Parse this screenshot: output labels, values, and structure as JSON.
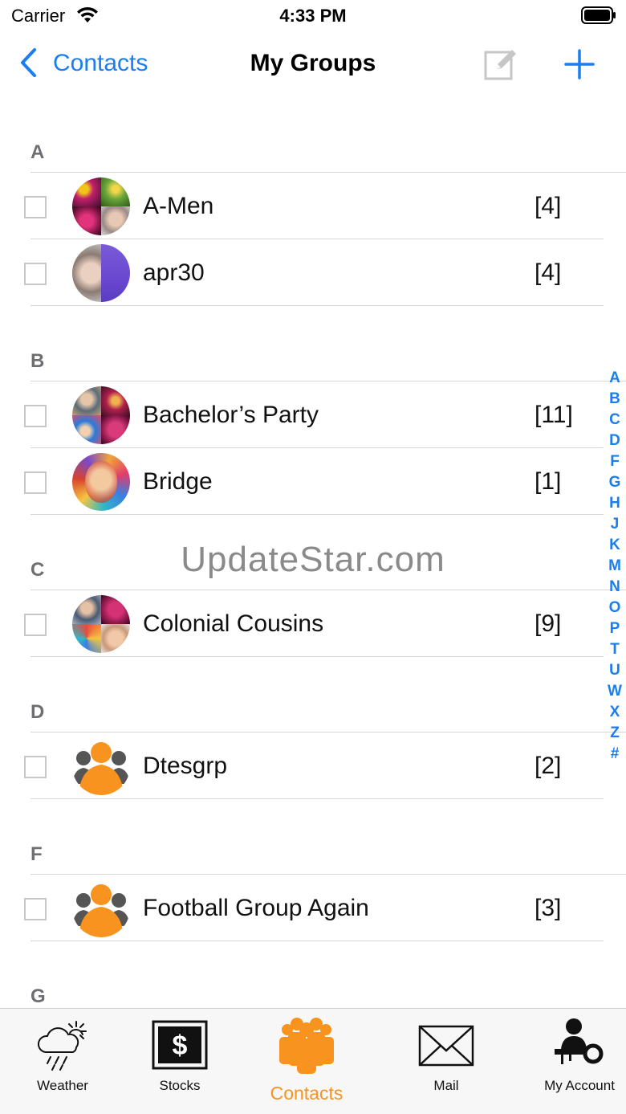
{
  "status_bar": {
    "carrier": "Carrier",
    "time": "4:33 PM"
  },
  "nav": {
    "back_label": "Contacts",
    "title": "My Groups",
    "edit_icon": "compose-icon",
    "add_icon": "plus-icon"
  },
  "colors": {
    "accent_blue": "#1a7ef0",
    "accent_orange": "#f7931e",
    "divider": "#d6d6d6",
    "section_text": "#6e6e73"
  },
  "sections": [
    {
      "letter": "A",
      "groups": [
        {
          "name": "A-Men",
          "count": "[4]"
        },
        {
          "name": "apr30",
          "count": "[4]"
        }
      ]
    },
    {
      "letter": "B",
      "groups": [
        {
          "name": "Bachelor’s Party",
          "count": "[11]"
        },
        {
          "name": "Bridge",
          "count": "[1]"
        }
      ]
    },
    {
      "letter": "C",
      "groups": [
        {
          "name": "Colonial Cousins",
          "count": "[9]"
        }
      ]
    },
    {
      "letter": "D",
      "groups": [
        {
          "name": "Dtesgrp",
          "count": "[2]"
        }
      ]
    },
    {
      "letter": "F",
      "groups": [
        {
          "name": "Football Group Again",
          "count": "[3]"
        }
      ]
    },
    {
      "letter": "G",
      "groups": []
    }
  ],
  "index_letters": [
    "A",
    "B",
    "C",
    "D",
    "F",
    "G",
    "H",
    "J",
    "K",
    "M",
    "N",
    "O",
    "P",
    "T",
    "U",
    "W",
    "X",
    "Z",
    "#"
  ],
  "watermark": "UpdateStar.com",
  "tabs": [
    {
      "label": "Weather",
      "icon": "weather-icon",
      "active": false
    },
    {
      "label": "Stocks",
      "icon": "stocks-dollar-icon",
      "active": false
    },
    {
      "label": "Contacts",
      "icon": "contacts-group-icon",
      "active": true
    },
    {
      "label": "Mail",
      "icon": "mail-envelope-icon",
      "active": false
    },
    {
      "label": "My Account",
      "icon": "account-key-icon",
      "active": false
    }
  ]
}
